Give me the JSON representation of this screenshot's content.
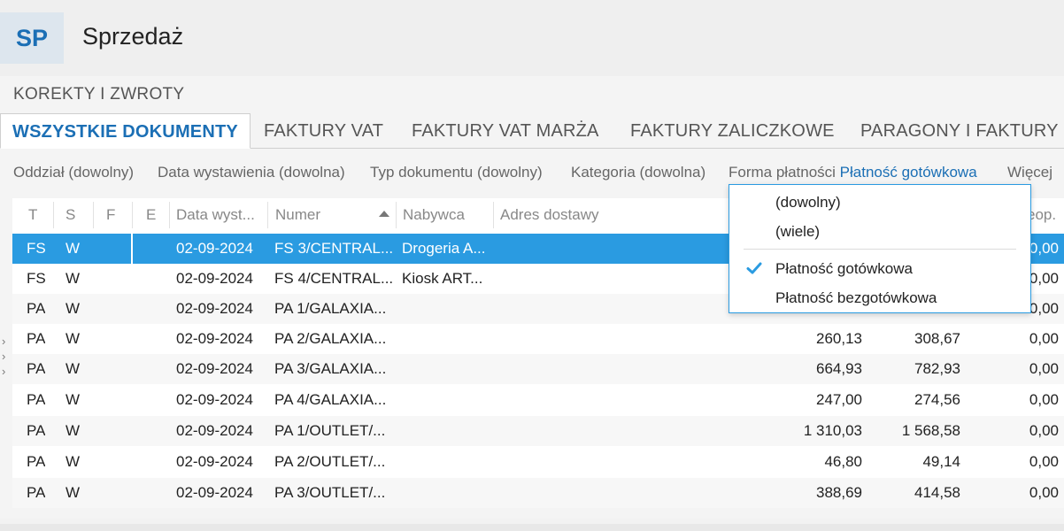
{
  "app": {
    "badge": "SP",
    "title": "Sprzedaż"
  },
  "corrections_label": "KOREKTY I ZWROTY",
  "tabs": [
    {
      "label": "WSZYSTKIE DOKUMENTY",
      "active": true
    },
    {
      "label": "FAKTURY VAT"
    },
    {
      "label": "FAKTURY VAT MARŻA"
    },
    {
      "label": "FAKTURY ZALICZKOWE"
    },
    {
      "label": "PARAGONY I FAKTURY U"
    }
  ],
  "filters": {
    "branch": "Oddział (dowolny)",
    "issue_date": "Data wystawienia (dowolna)",
    "doc_type": "Typ dokumentu (dowolny)",
    "category": "Kategoria (dowolna)",
    "payment_label": "Forma płatności",
    "payment_value": "Płatność gotówkowa",
    "more": "Więcej"
  },
  "grid": {
    "columns": [
      "T",
      "S",
      "F",
      "E",
      "Data wyst...",
      "Numer",
      "Nabywca",
      "Adres dostawy",
      "eop."
    ],
    "sort": {
      "column": "Numer",
      "direction": "ascending",
      "icon": "sort-ascending-icon"
    },
    "rows": [
      {
        "t": "FS",
        "s": "W",
        "date": "02-09-2024",
        "number": "FS 3/CENTRAL...",
        "buyer": "Drogeria A...",
        "net": "",
        "gross": "",
        "last": "0,00",
        "selected": true
      },
      {
        "t": "FS",
        "s": "W",
        "date": "02-09-2024",
        "number": "FS 4/CENTRAL...",
        "buyer": "Kiosk ART...",
        "net": "",
        "gross": "",
        "last": "0,00"
      },
      {
        "t": "PA",
        "s": "W",
        "date": "02-09-2024",
        "number": "PA 1/GALAXIA...",
        "buyer": "",
        "net": "",
        "gross": "",
        "last": "0,00"
      },
      {
        "t": "PA",
        "s": "W",
        "date": "02-09-2024",
        "number": "PA 2/GALAXIA...",
        "buyer": "",
        "net": "260,13",
        "gross": "308,67",
        "last": "0,00"
      },
      {
        "t": "PA",
        "s": "W",
        "date": "02-09-2024",
        "number": "PA 3/GALAXIA...",
        "buyer": "",
        "net": "664,93",
        "gross": "782,93",
        "last": "0,00"
      },
      {
        "t": "PA",
        "s": "W",
        "date": "02-09-2024",
        "number": "PA 4/GALAXIA...",
        "buyer": "",
        "net": "247,00",
        "gross": "274,56",
        "last": "0,00"
      },
      {
        "t": "PA",
        "s": "W",
        "date": "02-09-2024",
        "number": "PA 1/OUTLET/...",
        "buyer": "",
        "net": "1 310,03",
        "gross": "1 568,58",
        "last": "0,00"
      },
      {
        "t": "PA",
        "s": "W",
        "date": "02-09-2024",
        "number": "PA 2/OUTLET/...",
        "buyer": "",
        "net": "46,80",
        "gross": "49,14",
        "last": "0,00"
      },
      {
        "t": "PA",
        "s": "W",
        "date": "02-09-2024",
        "number": "PA 3/OUTLET/...",
        "buyer": "",
        "net": "388,69",
        "gross": "414,58",
        "last": "0,00"
      }
    ]
  },
  "dropdown": {
    "items": [
      "(dowolny)",
      "(wiele)",
      "Płatność gotówkowa",
      "Płatność bezgotówkowa"
    ],
    "checked": "Płatność gotówkowa",
    "check_icon": "checkmark-icon"
  },
  "side_expand_icon": "expand-chevrons-icon",
  "colors": {
    "accent": "#1b6fb5",
    "selection": "#2a9be1",
    "badge_bg": "#dde6ee"
  }
}
